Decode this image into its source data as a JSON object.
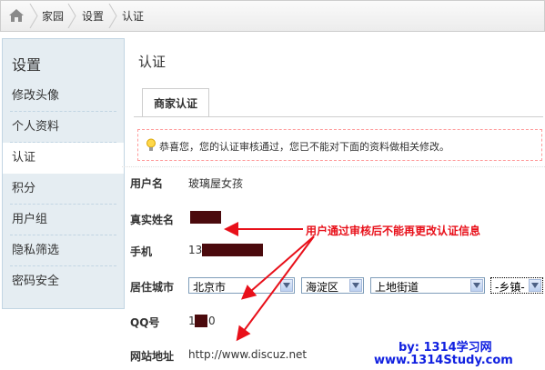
{
  "breadcrumb": {
    "items": [
      "家园",
      "设置",
      "认证"
    ]
  },
  "sidebar": {
    "title": "设置",
    "items": [
      {
        "label": "修改头像",
        "active": false
      },
      {
        "label": "个人资料",
        "active": false
      },
      {
        "label": "认证",
        "active": true
      },
      {
        "label": "积分",
        "active": false
      },
      {
        "label": "用户组",
        "active": false
      },
      {
        "label": "隐私筛选",
        "active": false
      },
      {
        "label": "密码安全",
        "active": false
      }
    ]
  },
  "main": {
    "title": "认证",
    "tab": "商家认证",
    "notice": "恭喜您，您的认证审核通过，您已不能对下面的资料做相关修改。"
  },
  "form": {
    "username_label": "用户名",
    "username": "玻璃屋女孩",
    "realname_label": "真实姓名",
    "phone_label": "手机",
    "phone_prefix": "13",
    "city_label": "居住城市",
    "city_selects": [
      "北京市",
      "海淀区",
      "上地街道",
      "-乡镇-"
    ],
    "qq_label": "QQ号",
    "qq_prefix": "1",
    "qq_suffix": "0",
    "website_label": "网站地址",
    "website": "http://www.discuz.net"
  },
  "annotation": {
    "text": "用户通过审核后不能再更改认证信息",
    "by": "by: 1314学习网",
    "site": "www.1314Study.com"
  },
  "colors": {
    "annotation": "#e8101a",
    "watermark": "#1020e0",
    "mask": "#4b0a0d"
  }
}
